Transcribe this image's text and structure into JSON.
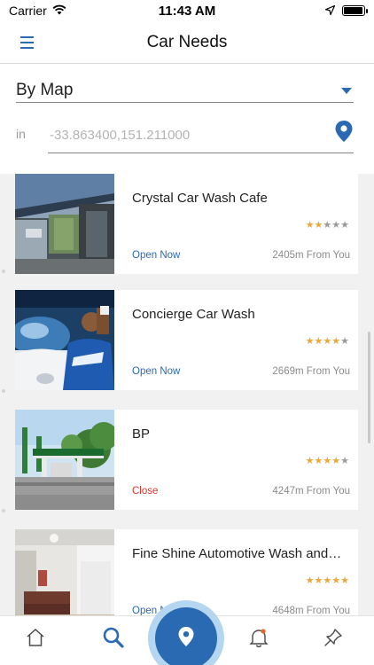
{
  "status_bar": {
    "carrier": "Carrier",
    "time": "11:43 AM",
    "battery_percent": 95
  },
  "header": {
    "title": "Car Needs",
    "menu_icon": "hamburger-menu-icon"
  },
  "filter": {
    "mode": "By Map",
    "location_label": "in",
    "location_placeholder": "-33.863400,151.211000"
  },
  "listings": [
    {
      "name": "Crystal Car Wash Cafe",
      "rating": 2,
      "status": "Open Now",
      "status_type": "open",
      "distance": "2405m From You",
      "thumb": "car-wash-bay-photo"
    },
    {
      "name": "Concierge Car Wash",
      "rating": 4,
      "status": "Open Now",
      "status_type": "open",
      "distance": "2669m From You",
      "thumb": "car-washing-worker-photo"
    },
    {
      "name": "BP",
      "rating": 4,
      "status": "Close",
      "status_type": "closed",
      "distance": "4247m From You",
      "thumb": "petrol-station-photo"
    },
    {
      "name": "Fine Shine Automotive Wash and…",
      "rating": 5,
      "status": "Open Now",
      "status_type": "open",
      "distance": "4648m From You",
      "thumb": "waiting-room-photo"
    }
  ],
  "tabs": [
    {
      "name": "home-tab",
      "icon": "home-icon"
    },
    {
      "name": "search-tab",
      "icon": "search-icon"
    },
    {
      "name": "map-tab",
      "icon": "map-pin-icon",
      "active": true
    },
    {
      "name": "notifications-tab",
      "icon": "bell-icon"
    },
    {
      "name": "pinned-tab",
      "icon": "pushpin-icon"
    }
  ],
  "colors": {
    "accent": "#2a6ab3",
    "star": "#e8a93a",
    "closed": "#d9322c",
    "fab_ring": "#b4d6f1"
  }
}
